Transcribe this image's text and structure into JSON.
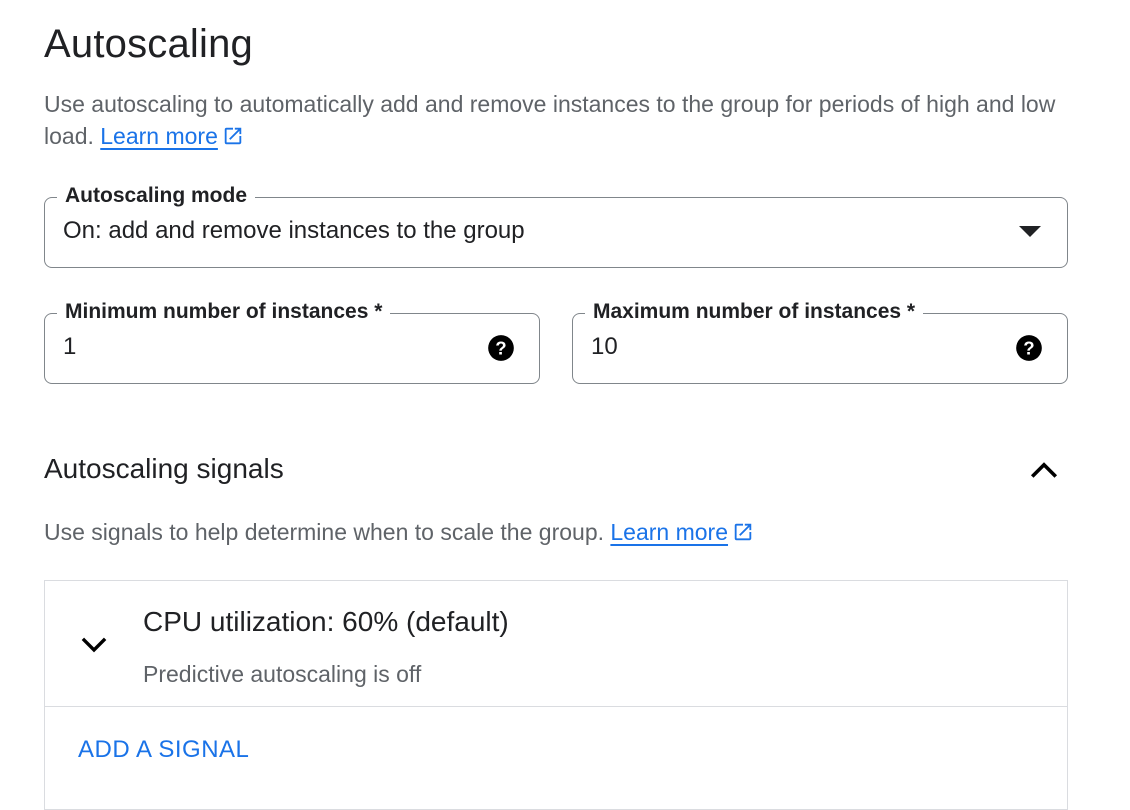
{
  "header": {
    "title": "Autoscaling",
    "description": "Use autoscaling to automatically add and remove instances to the group for periods of high and low load.",
    "learn_more": "Learn more"
  },
  "autoscaling_mode": {
    "label": "Autoscaling mode",
    "value": "On: add and remove instances to the group",
    "icon": "arrow-drop-down-icon"
  },
  "min_instances": {
    "label": "Minimum number of instances *",
    "value": "1",
    "icon": "help-icon"
  },
  "max_instances": {
    "label": "Maximum number of instances *",
    "value": "10",
    "icon": "help-icon"
  },
  "signals": {
    "title": "Autoscaling signals",
    "description": "Use signals to help determine when to scale the group.",
    "learn_more": "Learn more",
    "collapse_icon": "chevron-up-icon",
    "items": [
      {
        "title": "CPU utilization: 60% (default)",
        "subtitle": "Predictive autoscaling is off",
        "icon": "chevron-down-icon"
      }
    ],
    "add_label": "ADD A SIGNAL"
  },
  "colors": {
    "link": "#1a73e8",
    "text": "#202124",
    "secondary_text": "#5f6368",
    "border": "#80868b",
    "divider": "#dadce0"
  }
}
